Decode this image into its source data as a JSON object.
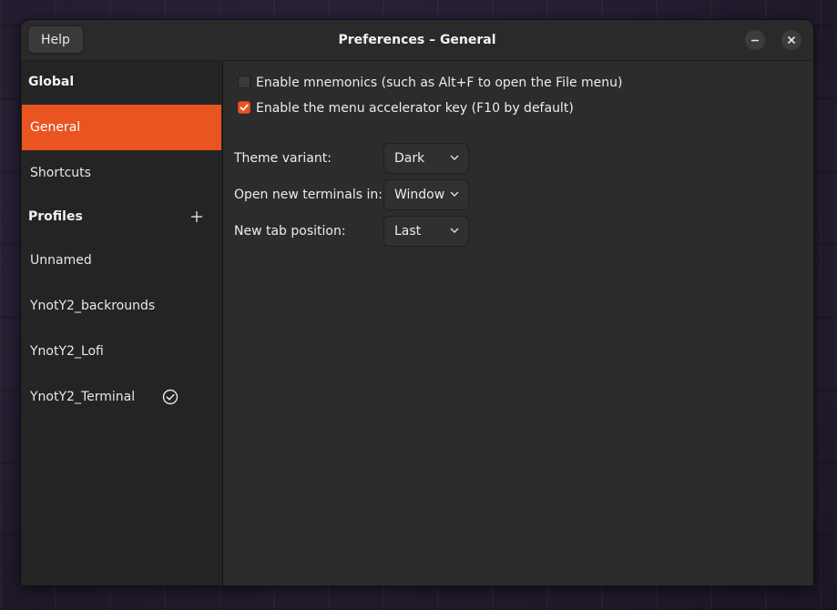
{
  "titlebar": {
    "help_label": "Help",
    "title": "Preferences – General",
    "minimize_glyph": "–",
    "close_glyph": "✕"
  },
  "sidebar": {
    "global_header": "Global",
    "global_items": [
      {
        "label": "General",
        "active": true
      },
      {
        "label": "Shortcuts",
        "active": false
      }
    ],
    "profiles_header": "Profiles",
    "add_profile_glyph": "+",
    "profiles": [
      {
        "label": "Unnamed",
        "default": false
      },
      {
        "label": "YnotY2_backrounds",
        "default": false
      },
      {
        "label": "YnotY2_Lofi",
        "default": false
      },
      {
        "label": "YnotY2_Terminal",
        "default": true
      }
    ],
    "default_icon": "check-circle-icon"
  },
  "general": {
    "mnemonics": {
      "label": "Enable mnemonics (such as Alt+F to open the File menu)",
      "checked": false
    },
    "accelerator": {
      "label": "Enable the menu accelerator key (F10 by default)",
      "checked": true
    },
    "theme_variant": {
      "label": "Theme variant:",
      "value": "Dark"
    },
    "open_new_terminals": {
      "label": "Open new terminals in:",
      "value": "Window"
    },
    "new_tab_position": {
      "label": "New tab position:",
      "value": "Last"
    }
  },
  "colors": {
    "accent": "#e95420",
    "window_bg": "#2c2c2c",
    "sidebar_bg": "#242424"
  }
}
